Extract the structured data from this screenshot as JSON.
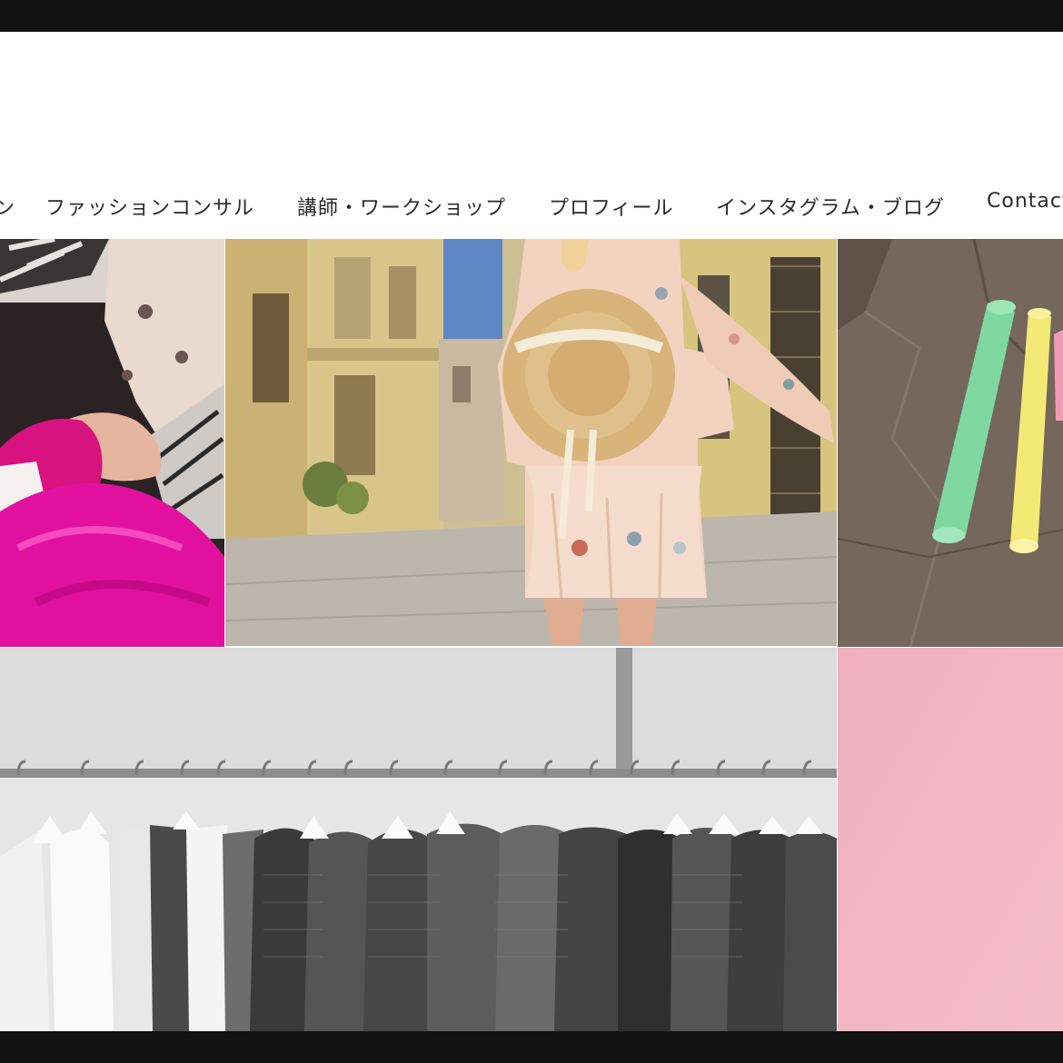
{
  "nav": {
    "items": [
      {
        "label": "ン"
      },
      {
        "label": "ファッションコンサル"
      },
      {
        "label": "講師・ワークショップ"
      },
      {
        "label": "プロフィール"
      },
      {
        "label": "インスタグラム・ブログ"
      },
      {
        "label": "Contact"
      }
    ]
  },
  "colors": {
    "frame": "#121212",
    "header_bg": "#ffffff",
    "nav_text": "#2a2a2a",
    "fabric_magenta": "#e2109f",
    "dress_peach": "#f3d3c0",
    "pink_tile": "#f2b5c3"
  },
  "gallery": {
    "tiles": [
      {
        "name": "sewing-fabric-photo"
      },
      {
        "name": "street-dress-hat-photo"
      },
      {
        "name": "chalk-sticks-photo"
      },
      {
        "name": "clothing-rack-photo"
      },
      {
        "name": "pink-background-photo"
      }
    ]
  }
}
